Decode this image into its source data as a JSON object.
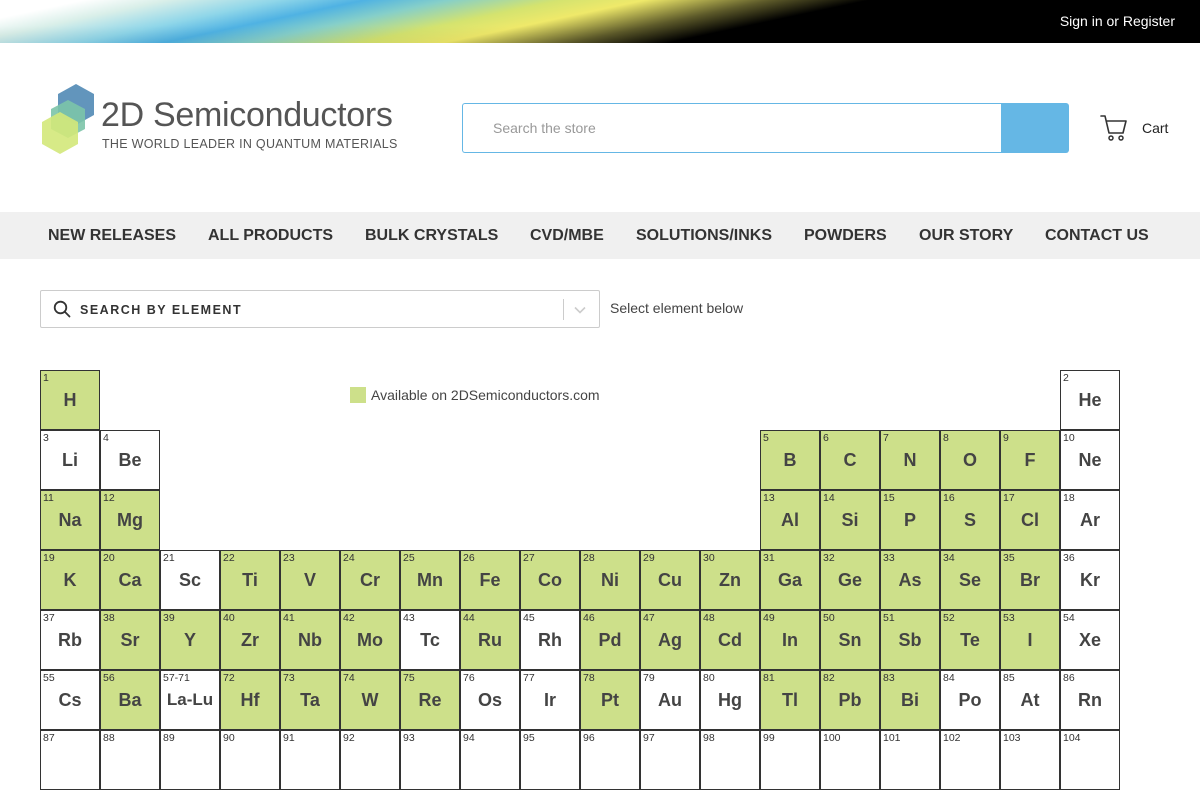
{
  "topbar": {
    "signin": "Sign in",
    "or": "or",
    "register": "Register"
  },
  "logo": {
    "title": "2D Semiconductors",
    "tagline": "THE WORLD LEADER IN QUANTUM MATERIALS"
  },
  "search": {
    "placeholder": "Search the store",
    "button_icon": "search-icon"
  },
  "cart": {
    "label": "Cart",
    "icon": "cart-icon"
  },
  "nav": [
    {
      "label": "NEW RELEASES"
    },
    {
      "label": "ALL PRODUCTS"
    },
    {
      "label": "BULK CRYSTALS"
    },
    {
      "label": "CVD/MBE"
    },
    {
      "label": "SOLUTIONS/INKS"
    },
    {
      "label": "POWDERS"
    },
    {
      "label": "OUR STORY"
    },
    {
      "label": "CONTACT US"
    }
  ],
  "element_search": {
    "label": "SEARCH BY ELEMENT",
    "hint": "Select element below"
  },
  "legend": {
    "text": "Available on 2DSemiconductors.com",
    "color": "#cde08a"
  },
  "colors": {
    "accent": "#65b7e5",
    "available": "#cde08a",
    "nav_bg": "#f0f0f0"
  },
  "elements": [
    {
      "n": "1",
      "s": "H",
      "r": 0,
      "c": 0,
      "a": true
    },
    {
      "n": "2",
      "s": "He",
      "r": 0,
      "c": 17,
      "a": false
    },
    {
      "n": "3",
      "s": "Li",
      "r": 1,
      "c": 0,
      "a": false
    },
    {
      "n": "4",
      "s": "Be",
      "r": 1,
      "c": 1,
      "a": false
    },
    {
      "n": "5",
      "s": "B",
      "r": 1,
      "c": 12,
      "a": true
    },
    {
      "n": "6",
      "s": "C",
      "r": 1,
      "c": 13,
      "a": true
    },
    {
      "n": "7",
      "s": "N",
      "r": 1,
      "c": 14,
      "a": true
    },
    {
      "n": "8",
      "s": "O",
      "r": 1,
      "c": 15,
      "a": true
    },
    {
      "n": "9",
      "s": "F",
      "r": 1,
      "c": 16,
      "a": true
    },
    {
      "n": "10",
      "s": "Ne",
      "r": 1,
      "c": 17,
      "a": false
    },
    {
      "n": "11",
      "s": "Na",
      "r": 2,
      "c": 0,
      "a": true
    },
    {
      "n": "12",
      "s": "Mg",
      "r": 2,
      "c": 1,
      "a": true
    },
    {
      "n": "13",
      "s": "Al",
      "r": 2,
      "c": 12,
      "a": true
    },
    {
      "n": "14",
      "s": "Si",
      "r": 2,
      "c": 13,
      "a": true
    },
    {
      "n": "15",
      "s": "P",
      "r": 2,
      "c": 14,
      "a": true
    },
    {
      "n": "16",
      "s": "S",
      "r": 2,
      "c": 15,
      "a": true
    },
    {
      "n": "17",
      "s": "Cl",
      "r": 2,
      "c": 16,
      "a": true
    },
    {
      "n": "18",
      "s": "Ar",
      "r": 2,
      "c": 17,
      "a": false
    },
    {
      "n": "19",
      "s": "K",
      "r": 3,
      "c": 0,
      "a": true
    },
    {
      "n": "20",
      "s": "Ca",
      "r": 3,
      "c": 1,
      "a": true
    },
    {
      "n": "21",
      "s": "Sc",
      "r": 3,
      "c": 2,
      "a": false
    },
    {
      "n": "22",
      "s": "Ti",
      "r": 3,
      "c": 3,
      "a": true
    },
    {
      "n": "23",
      "s": "V",
      "r": 3,
      "c": 4,
      "a": true
    },
    {
      "n": "24",
      "s": "Cr",
      "r": 3,
      "c": 5,
      "a": true
    },
    {
      "n": "25",
      "s": "Mn",
      "r": 3,
      "c": 6,
      "a": true
    },
    {
      "n": "26",
      "s": "Fe",
      "r": 3,
      "c": 7,
      "a": true
    },
    {
      "n": "27",
      "s": "Co",
      "r": 3,
      "c": 8,
      "a": true
    },
    {
      "n": "28",
      "s": "Ni",
      "r": 3,
      "c": 9,
      "a": true
    },
    {
      "n": "29",
      "s": "Cu",
      "r": 3,
      "c": 10,
      "a": true
    },
    {
      "n": "30",
      "s": "Zn",
      "r": 3,
      "c": 11,
      "a": true
    },
    {
      "n": "31",
      "s": "Ga",
      "r": 3,
      "c": 12,
      "a": true
    },
    {
      "n": "32",
      "s": "Ge",
      "r": 3,
      "c": 13,
      "a": true
    },
    {
      "n": "33",
      "s": "As",
      "r": 3,
      "c": 14,
      "a": true
    },
    {
      "n": "34",
      "s": "Se",
      "r": 3,
      "c": 15,
      "a": true
    },
    {
      "n": "35",
      "s": "Br",
      "r": 3,
      "c": 16,
      "a": true
    },
    {
      "n": "36",
      "s": "Kr",
      "r": 3,
      "c": 17,
      "a": false
    },
    {
      "n": "37",
      "s": "Rb",
      "r": 4,
      "c": 0,
      "a": false
    },
    {
      "n": "38",
      "s": "Sr",
      "r": 4,
      "c": 1,
      "a": true
    },
    {
      "n": "39",
      "s": "Y",
      "r": 4,
      "c": 2,
      "a": true
    },
    {
      "n": "40",
      "s": "Zr",
      "r": 4,
      "c": 3,
      "a": true
    },
    {
      "n": "41",
      "s": "Nb",
      "r": 4,
      "c": 4,
      "a": true
    },
    {
      "n": "42",
      "s": "Mo",
      "r": 4,
      "c": 5,
      "a": true
    },
    {
      "n": "43",
      "s": "Tc",
      "r": 4,
      "c": 6,
      "a": false
    },
    {
      "n": "44",
      "s": "Ru",
      "r": 4,
      "c": 7,
      "a": true
    },
    {
      "n": "45",
      "s": "Rh",
      "r": 4,
      "c": 8,
      "a": false
    },
    {
      "n": "46",
      "s": "Pd",
      "r": 4,
      "c": 9,
      "a": true
    },
    {
      "n": "47",
      "s": "Ag",
      "r": 4,
      "c": 10,
      "a": true
    },
    {
      "n": "48",
      "s": "Cd",
      "r": 4,
      "c": 11,
      "a": true
    },
    {
      "n": "49",
      "s": "In",
      "r": 4,
      "c": 12,
      "a": true
    },
    {
      "n": "50",
      "s": "Sn",
      "r": 4,
      "c": 13,
      "a": true
    },
    {
      "n": "51",
      "s": "Sb",
      "r": 4,
      "c": 14,
      "a": true
    },
    {
      "n": "52",
      "s": "Te",
      "r": 4,
      "c": 15,
      "a": true
    },
    {
      "n": "53",
      "s": "I",
      "r": 4,
      "c": 16,
      "a": true
    },
    {
      "n": "54",
      "s": "Xe",
      "r": 4,
      "c": 17,
      "a": false
    },
    {
      "n": "55",
      "s": "Cs",
      "r": 5,
      "c": 0,
      "a": false
    },
    {
      "n": "56",
      "s": "Ba",
      "r": 5,
      "c": 1,
      "a": true
    },
    {
      "n": "57-71",
      "s": "La-Lu",
      "r": 5,
      "c": 2,
      "a": false
    },
    {
      "n": "72",
      "s": "Hf",
      "r": 5,
      "c": 3,
      "a": true
    },
    {
      "n": "73",
      "s": "Ta",
      "r": 5,
      "c": 4,
      "a": true
    },
    {
      "n": "74",
      "s": "W",
      "r": 5,
      "c": 5,
      "a": true
    },
    {
      "n": "75",
      "s": "Re",
      "r": 5,
      "c": 6,
      "a": true
    },
    {
      "n": "76",
      "s": "Os",
      "r": 5,
      "c": 7,
      "a": false
    },
    {
      "n": "77",
      "s": "Ir",
      "r": 5,
      "c": 8,
      "a": false
    },
    {
      "n": "78",
      "s": "Pt",
      "r": 5,
      "c": 9,
      "a": true
    },
    {
      "n": "79",
      "s": "Au",
      "r": 5,
      "c": 10,
      "a": false
    },
    {
      "n": "80",
      "s": "Hg",
      "r": 5,
      "c": 11,
      "a": false
    },
    {
      "n": "81",
      "s": "Tl",
      "r": 5,
      "c": 12,
      "a": true
    },
    {
      "n": "82",
      "s": "Pb",
      "r": 5,
      "c": 13,
      "a": true
    },
    {
      "n": "83",
      "s": "Bi",
      "r": 5,
      "c": 14,
      "a": true
    },
    {
      "n": "84",
      "s": "Po",
      "r": 5,
      "c": 15,
      "a": false
    },
    {
      "n": "85",
      "s": "At",
      "r": 5,
      "c": 16,
      "a": false
    },
    {
      "n": "86",
      "s": "Rn",
      "r": 5,
      "c": 17,
      "a": false
    },
    {
      "n": "87",
      "s": "",
      "r": 6,
      "c": 0,
      "a": false
    },
    {
      "n": "88",
      "s": "",
      "r": 6,
      "c": 1,
      "a": false
    },
    {
      "n": "89",
      "s": "",
      "r": 6,
      "c": 2,
      "a": false
    },
    {
      "n": "90",
      "s": "",
      "r": 6,
      "c": 3,
      "a": false
    },
    {
      "n": "91",
      "s": "",
      "r": 6,
      "c": 4,
      "a": false
    },
    {
      "n": "92",
      "s": "",
      "r": 6,
      "c": 5,
      "a": false
    },
    {
      "n": "93",
      "s": "",
      "r": 6,
      "c": 6,
      "a": false
    },
    {
      "n": "94",
      "s": "",
      "r": 6,
      "c": 7,
      "a": false
    },
    {
      "n": "95",
      "s": "",
      "r": 6,
      "c": 8,
      "a": false
    },
    {
      "n": "96",
      "s": "",
      "r": 6,
      "c": 9,
      "a": false
    },
    {
      "n": "97",
      "s": "",
      "r": 6,
      "c": 10,
      "a": false
    },
    {
      "n": "98",
      "s": "",
      "r": 6,
      "c": 11,
      "a": false
    },
    {
      "n": "99",
      "s": "",
      "r": 6,
      "c": 12,
      "a": false
    },
    {
      "n": "100",
      "s": "",
      "r": 6,
      "c": 13,
      "a": false
    },
    {
      "n": "101",
      "s": "",
      "r": 6,
      "c": 14,
      "a": false
    },
    {
      "n": "102",
      "s": "",
      "r": 6,
      "c": 15,
      "a": false
    },
    {
      "n": "103",
      "s": "",
      "r": 6,
      "c": 16,
      "a": false
    },
    {
      "n": "104",
      "s": "",
      "r": 6,
      "c": 17,
      "a": false
    }
  ]
}
